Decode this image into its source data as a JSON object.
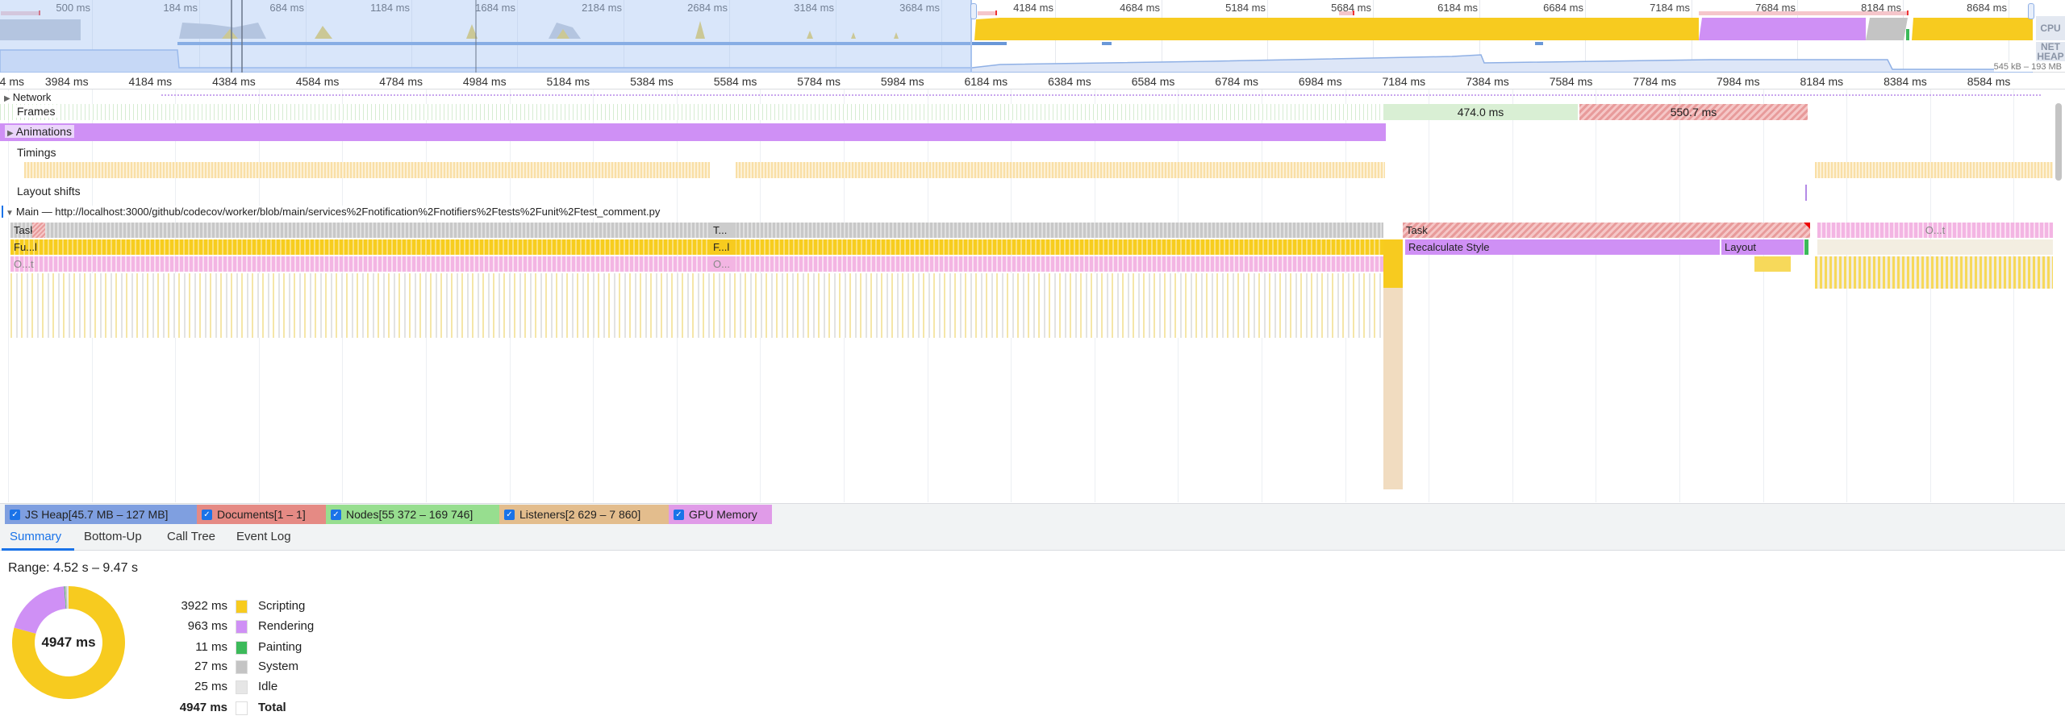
{
  "overview": {
    "ticks": [
      "500 ms",
      "184 ms",
      "684 ms",
      "1184 ms",
      "1684 ms",
      "2184 ms",
      "2684 ms",
      "3184 ms",
      "3684 ms",
      "4184 ms",
      "4684 ms",
      "5184 ms",
      "5684 ms",
      "6184 ms",
      "6684 ms",
      "7184 ms",
      "7684 ms",
      "8184 ms",
      "8684 ms"
    ],
    "labels": {
      "cpu": "CPU",
      "net": "NET",
      "heap": "HEAP"
    },
    "heap_range": "545 kB – 193 MB"
  },
  "ruler": {
    "ticks": [
      "4 ms",
      "3984 ms",
      "4184 ms",
      "4384 ms",
      "4584 ms",
      "4784 ms",
      "4984 ms",
      "5184 ms",
      "5384 ms",
      "5584 ms",
      "5784 ms",
      "5984 ms",
      "6184 ms",
      "6384 ms",
      "6584 ms",
      "6784 ms",
      "6984 ms",
      "7184 ms",
      "7384 ms",
      "7584 ms",
      "7784 ms",
      "7984 ms",
      "8184 ms",
      "8384 ms",
      "8584 ms"
    ]
  },
  "tracks": {
    "network": "Network",
    "frames": "Frames",
    "frame_blocks": [
      "474.0 ms",
      "550.7 ms"
    ],
    "animations": "Animations",
    "timings": "Timings",
    "layout_shifts": "Layout shifts",
    "main": "Main — http://localhost:3000/github/codecov/worker/blob/main/services%2Fnotification%2Fnotifiers%2Ftests%2Funit%2Ftest_comment.py"
  },
  "flame": {
    "task": "Task",
    "task_short": "T...",
    "func": "Fu...l",
    "func_short": "F...l",
    "other": "O...t",
    "other_short": "O...",
    "long_task": "Task",
    "recalc": "Recalculate Style",
    "layout": "Layout"
  },
  "counters": [
    {
      "label": "JS Heap[45.7 MB – 127 MB]",
      "color": "#7f9fe0",
      "checked": true
    },
    {
      "label": "Documents[1 – 1]",
      "color": "#e58a84",
      "checked": true
    },
    {
      "label": "Nodes[55 372 – 169 746]",
      "color": "#97de8f",
      "checked": true
    },
    {
      "label": "Listeners[2 629 – 7 860]",
      "color": "#e3bd8d",
      "checked": true
    },
    {
      "label": "GPU Memory",
      "color": "#e09be8",
      "checked": true
    }
  ],
  "tabs": [
    {
      "label": "Summary",
      "active": true
    },
    {
      "label": "Bottom-Up"
    },
    {
      "label": "Call Tree"
    },
    {
      "label": "Event Log"
    }
  ],
  "summary": {
    "range": "Range: 4.52 s – 9.47 s",
    "total_center": "4947 ms",
    "items": [
      {
        "value": "3922 ms",
        "label": "Scripting",
        "color": "#f7cb1f",
        "ms": 3922
      },
      {
        "value": "963 ms",
        "label": "Rendering",
        "color": "#cf90f5",
        "ms": 963
      },
      {
        "value": "11 ms",
        "label": "Painting",
        "color": "#3cba5a",
        "ms": 11
      },
      {
        "value": "27 ms",
        "label": "System",
        "color": "#c4c4c4",
        "ms": 27
      },
      {
        "value": "25 ms",
        "label": "Idle",
        "color": "#e6e6e6",
        "ms": 25
      },
      {
        "value": "4947 ms",
        "label": "Total",
        "color": "#ffffff"
      }
    ]
  }
}
